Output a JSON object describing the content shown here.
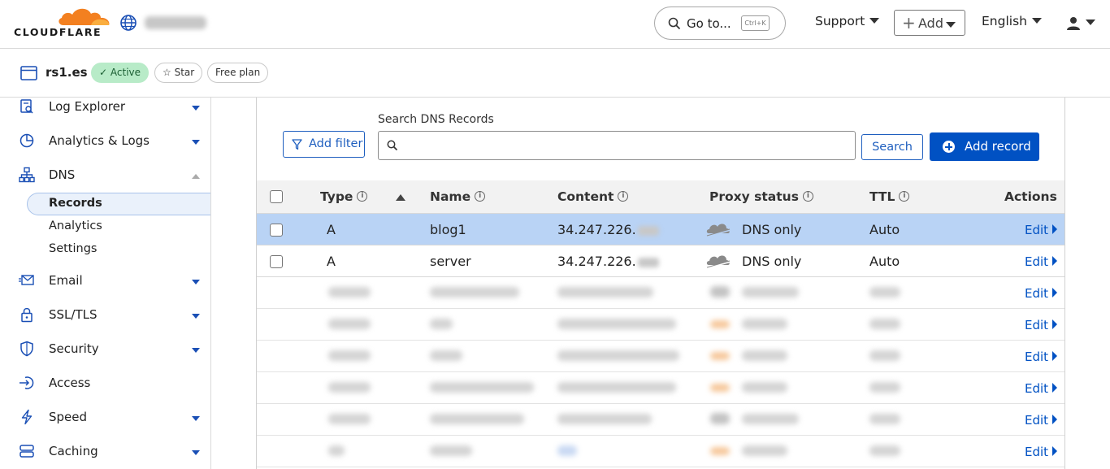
{
  "header": {
    "brand": "CLOUDFLARE",
    "goto_label": "Go to...",
    "goto_shortcut": "Ctrl+K",
    "support_label": "Support",
    "add_label": "Add",
    "language_label": "English"
  },
  "zone": {
    "name": "rs1.es",
    "status": "Active",
    "star_label": "Star",
    "plan": "Free plan"
  },
  "sidebar": {
    "items": [
      {
        "label": "Log Explorer",
        "icon": "log-explorer-icon"
      },
      {
        "label": "Analytics & Logs",
        "icon": "analytics-icon"
      },
      {
        "label": "DNS",
        "icon": "dns-icon"
      },
      {
        "label": "Email",
        "icon": "email-icon"
      },
      {
        "label": "SSL/TLS",
        "icon": "lock-icon"
      },
      {
        "label": "Security",
        "icon": "shield-icon"
      },
      {
        "label": "Access",
        "icon": "access-icon"
      },
      {
        "label": "Speed",
        "icon": "lightning-icon"
      },
      {
        "label": "Caching",
        "icon": "caching-icon"
      }
    ],
    "dns_sub": [
      "Records",
      "Analytics",
      "Settings"
    ]
  },
  "toolbar": {
    "add_filter_label": "Add filter",
    "search_label": "Search DNS Records",
    "search_value": "",
    "search_button_label": "Search",
    "add_record_label": "Add record"
  },
  "table": {
    "headers": {
      "type": "Type",
      "name": "Name",
      "content": "Content",
      "proxy": "Proxy status",
      "ttl": "TTL",
      "actions": "Actions"
    },
    "rows": [
      {
        "type": "A",
        "name": "blog1",
        "content": "34.247.226.",
        "proxy": "DNS only",
        "ttl": "Auto",
        "action": "Edit"
      },
      {
        "type": "A",
        "name": "server",
        "content": "34.247.226.",
        "proxy": "DNS only",
        "ttl": "Auto",
        "action": "Edit"
      }
    ],
    "edit_label": "Edit"
  },
  "colors": {
    "accent": "#0051c3",
    "active_badge": "#b8ebc8",
    "selected_row": "#b9d3f5",
    "brand_orange": "#f38020"
  }
}
